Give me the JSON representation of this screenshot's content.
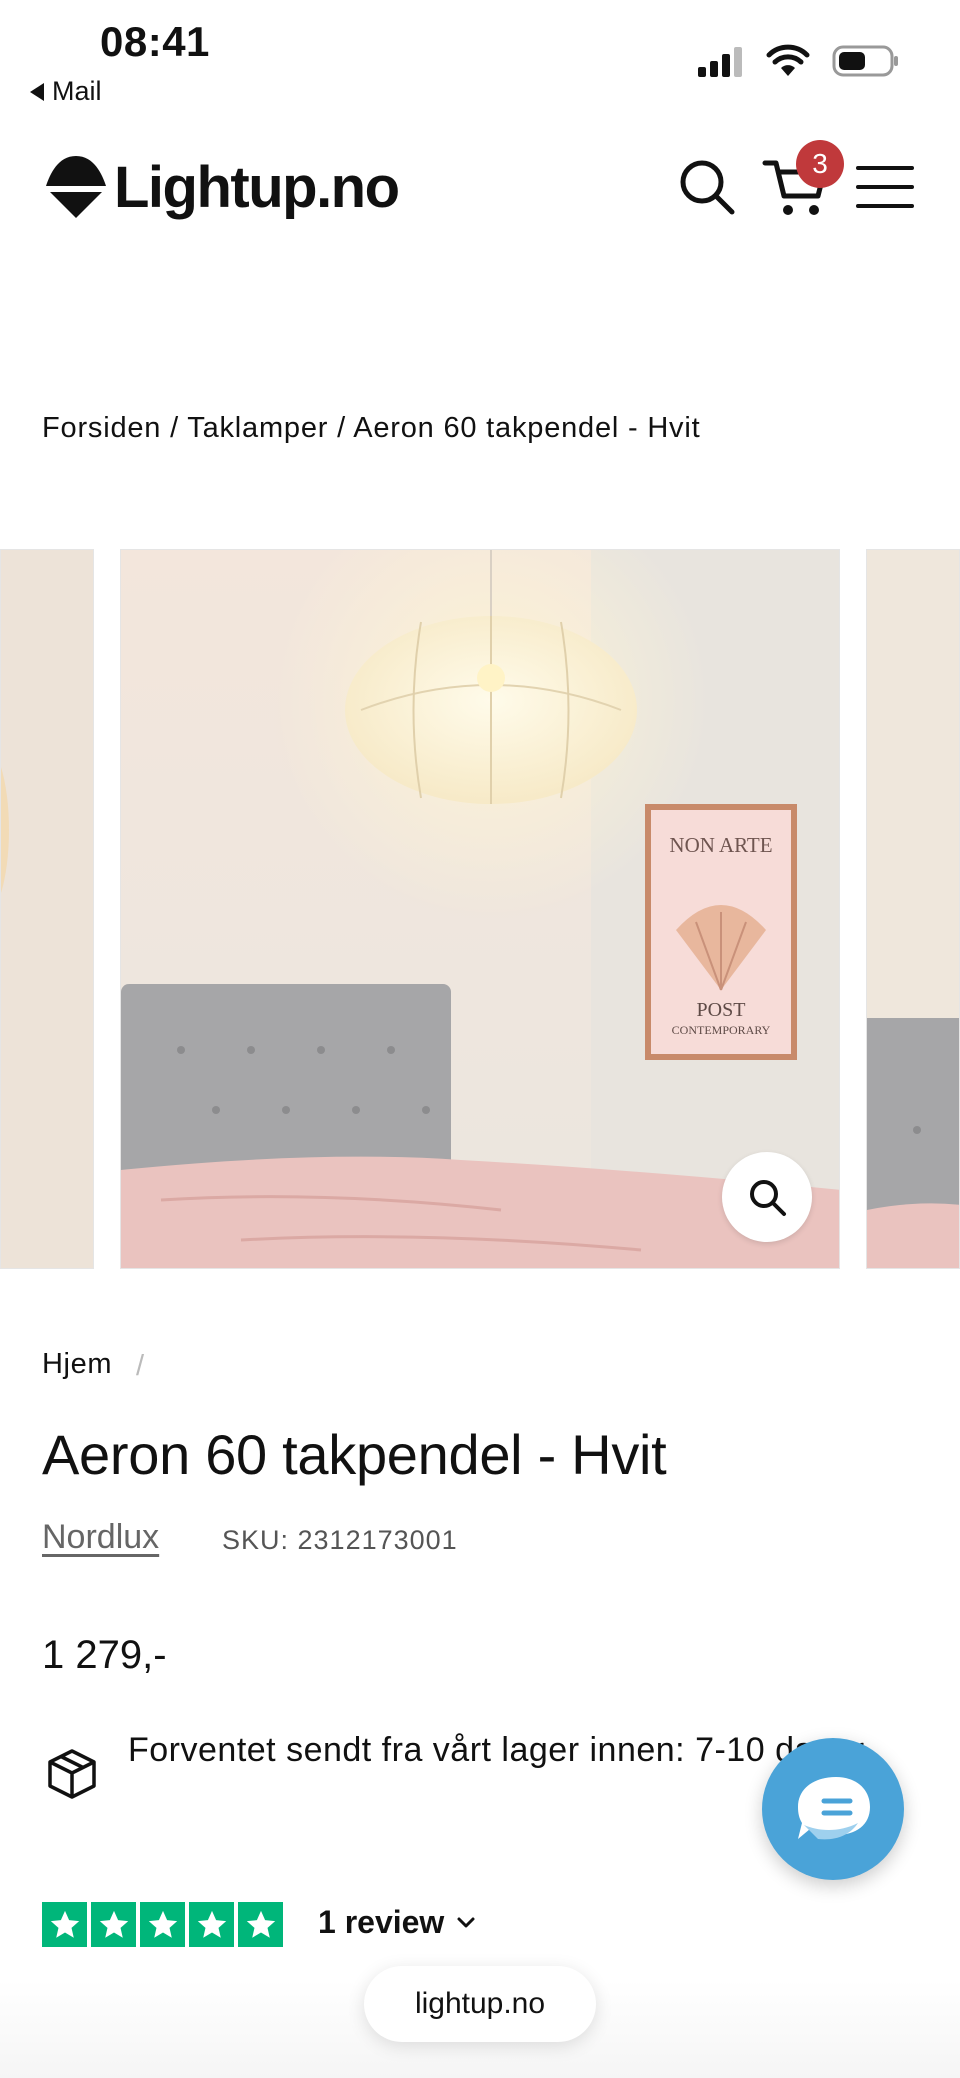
{
  "status_bar": {
    "time": "08:41",
    "back_label": "Mail"
  },
  "header": {
    "logo_text": "Lightup.no",
    "cart_count": "3"
  },
  "breadcrumb": {
    "text": "Forsiden / Taklamper / Aeron 60 takpendel - Hvit"
  },
  "gallery": {
    "poster_title": "NON ARTE",
    "poster_bottom_1": "POST",
    "poster_bottom_2": "CONTEMPORARY"
  },
  "product": {
    "breadcrumb_home": "Hjem",
    "breadcrumb_sep": "/",
    "title": "Aeron 60 takpendel - Hvit",
    "vendor": "Nordlux",
    "sku": "SKU: 2312173001",
    "price": "1 279,-",
    "shipping": "Forventet sendt fra vårt lager innen: 7-10 dager"
  },
  "reviews": {
    "rating": 5,
    "label": "1 review"
  },
  "browser": {
    "url": "lightup.no"
  },
  "colors": {
    "badge": "#c0393b",
    "trustpilot": "#00b67a",
    "chat": "#4aa3d8"
  }
}
